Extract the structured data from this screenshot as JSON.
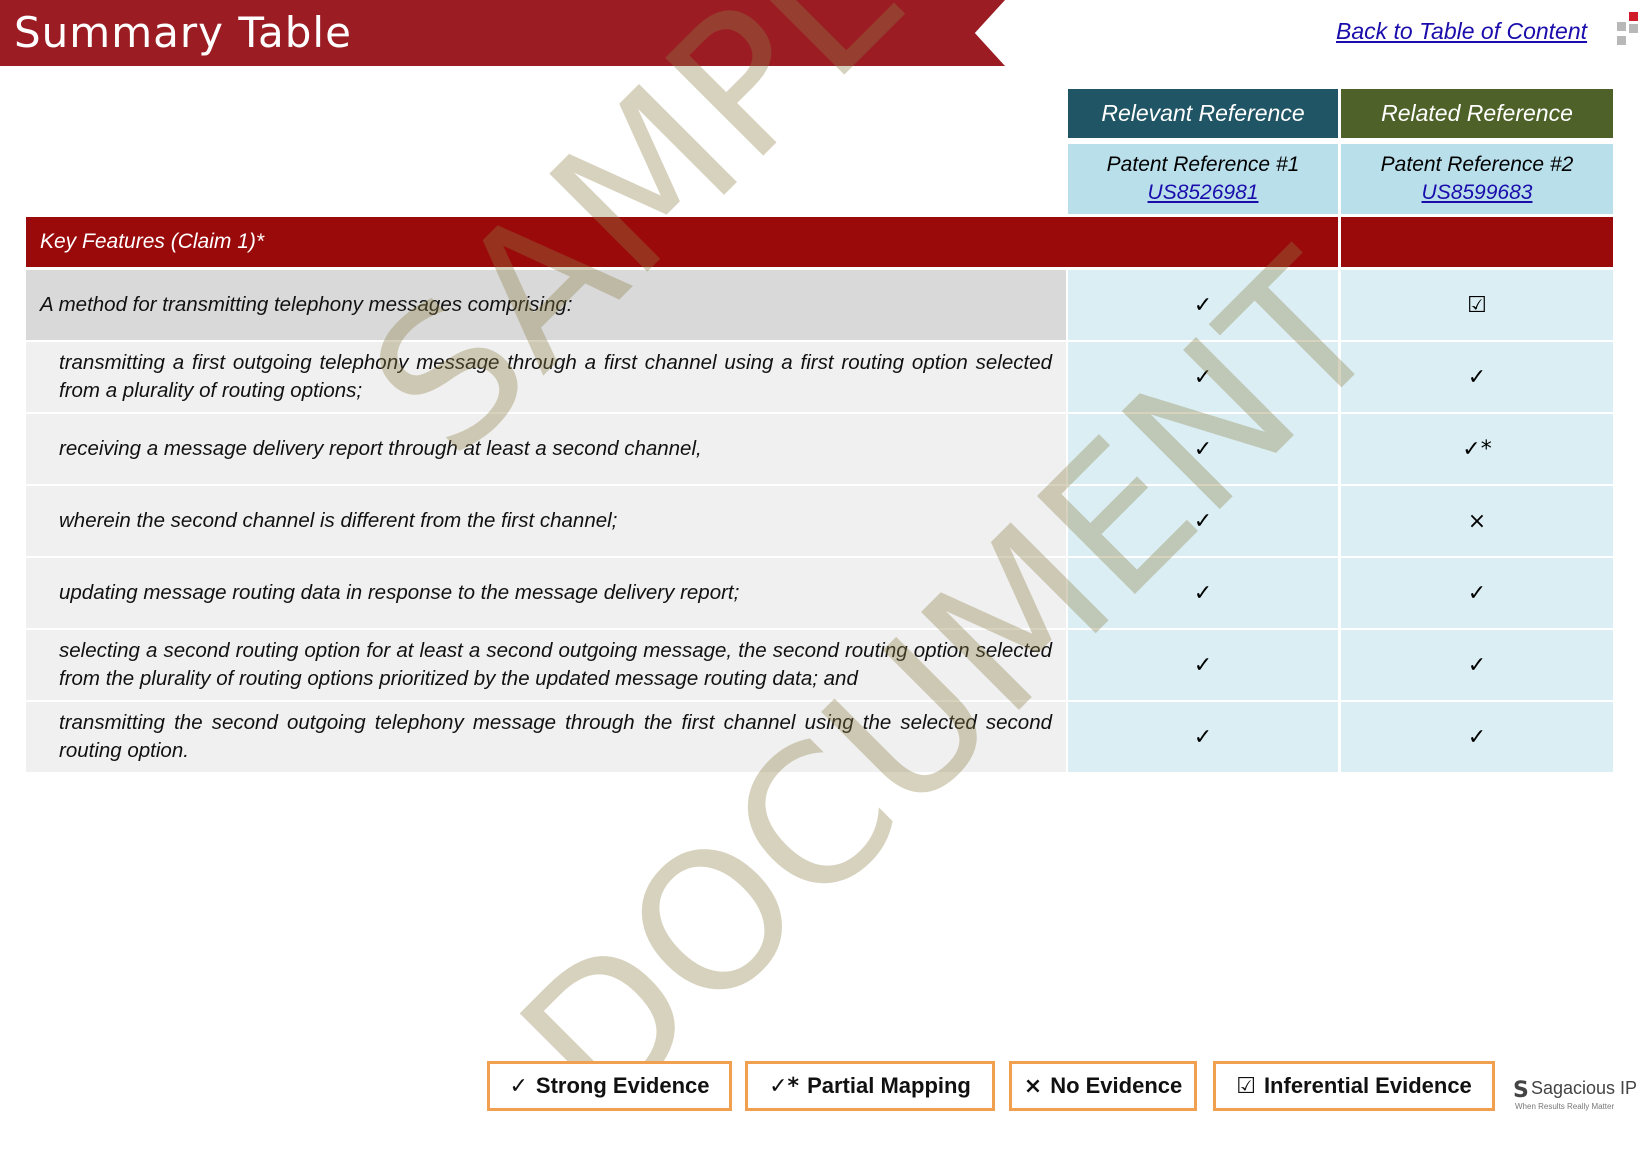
{
  "header": {
    "title": "Summary Table",
    "back_link": "Back to Table of Content",
    "accent_color": "#9c1c24"
  },
  "references": {
    "relevant_label": "Relevant Reference",
    "related_label": "Related Reference",
    "ref1_title": "Patent Reference #1",
    "ref1_number": "US8526981",
    "ref2_title": "Patent Reference #2",
    "ref2_number": "US8599683"
  },
  "table": {
    "section_label": "Key Features (Claim 1)*",
    "rows": [
      {
        "claim": "A method for transmitting telephony messages comprising:",
        "ref1": "✓",
        "ref2": "☑"
      },
      {
        "claim": "transmitting a first outgoing telephony message through a first channel using a first routing option selected from a plurality of routing options;",
        "ref1": "✓",
        "ref2": "✓"
      },
      {
        "claim": "receiving a message delivery report through at least a second channel,",
        "ref1": "✓",
        "ref2": "✓*"
      },
      {
        "claim": "wherein the second channel is different from the first channel;",
        "ref1": "✓",
        "ref2": "×"
      },
      {
        "claim": "updating message routing data in response to the message delivery report;",
        "ref1": "✓",
        "ref2": "✓"
      },
      {
        "claim": "selecting a second routing option for at least a second outgoing message, the second routing option selected from the plurality of routing options prioritized by the updated message routing data; and",
        "ref1": "✓",
        "ref2": "✓"
      },
      {
        "claim": "transmitting the second outgoing telephony message through the first channel using the selected second routing option.",
        "ref1": "✓",
        "ref2": "✓"
      }
    ]
  },
  "watermark": {
    "line1": "SAMPLE",
    "line2": "DOCUMENT"
  },
  "legend": [
    {
      "symbol": "✓",
      "label": "Strong Evidence"
    },
    {
      "symbol": "✓*",
      "label": "Partial Mapping"
    },
    {
      "symbol": "×",
      "label": "No Evidence"
    },
    {
      "symbol": "☑",
      "label": "Inferential Evidence"
    }
  ],
  "brand": {
    "mark": "S",
    "name": "Sagacious IP",
    "tagline": "When Results Really Matter"
  }
}
